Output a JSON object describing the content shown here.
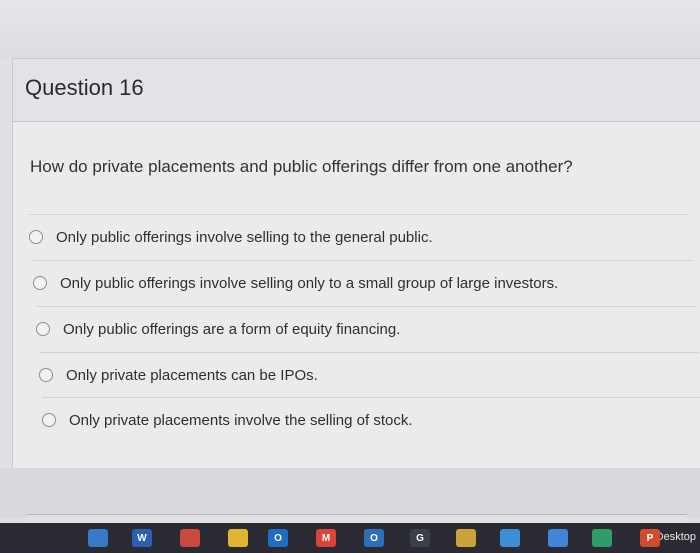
{
  "question": {
    "title": "Question 16",
    "prompt": "How do private placements and public offerings differ from one another?",
    "options": [
      "Only public offerings involve selling to the general public.",
      "Only public offerings involve selling only to a small group of large investors.",
      "Only public offerings are a form of equity financing.",
      "Only private placements can be IPOs.",
      "Only private placements involve the selling of stock."
    ]
  },
  "taskbar": {
    "desktop_label": "Desktop",
    "icons": [
      {
        "name": "calendar-icon",
        "label": "",
        "color": "#3a78c8"
      },
      {
        "name": "word-icon",
        "label": "W",
        "color": "#2b5fb3"
      },
      {
        "name": "app-icon",
        "label": "",
        "color": "#c94a3c"
      },
      {
        "name": "chrome-icon",
        "label": "",
        "color": "#e0b531"
      },
      {
        "name": "outlook-icon",
        "label": "O",
        "color": "#1f6dc4"
      },
      {
        "name": "gmail-icon",
        "label": "M",
        "color": "#d9453a"
      },
      {
        "name": "mail-icon",
        "label": "O",
        "color": "#2f6fb8"
      },
      {
        "name": "google-icon",
        "label": "G",
        "color": "#3c3f46"
      },
      {
        "name": "files-icon",
        "label": "",
        "color": "#caa33b"
      },
      {
        "name": "bars-icon",
        "label": "",
        "color": "#3b8ed8"
      },
      {
        "name": "list-icon",
        "label": "",
        "color": "#3f86d6"
      },
      {
        "name": "globe-icon",
        "label": "",
        "color": "#2f9c6a"
      },
      {
        "name": "powerpoint-icon",
        "label": "P",
        "color": "#d24b2f"
      }
    ]
  }
}
